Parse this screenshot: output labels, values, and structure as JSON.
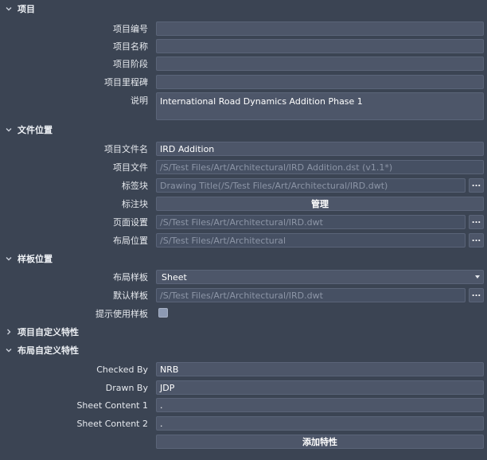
{
  "sections": {
    "project": "项目",
    "file_location": "文件位置",
    "template_location": "样板位置",
    "project_custom": "项目自定义特性",
    "layout_custom": "布局自定义特性"
  },
  "project": {
    "number_label": "项目编号",
    "number_value": "",
    "name_label": "项目名称",
    "name_value": "",
    "phase_label": "项目阶段",
    "phase_value": "",
    "milestone_label": "项目里程碑",
    "milestone_value": "",
    "desc_label": "说明",
    "desc_value": "International Road Dynamics Addition Phase 1"
  },
  "file_location": {
    "filename_label": "项目文件名",
    "filename_value": "IRD Addition",
    "file_label": "项目文件",
    "file_value": "/S/Test Files/Art/Architectural/IRD Addition.dst (v1.1*)",
    "label_block_label": "标签块",
    "label_block_value": "Drawing Title(/S/Test Files/Art/Architectural/IRD.dwt)",
    "annot_block_label": "标注块",
    "annot_block_button": "管理",
    "page_setup_label": "页面设置",
    "page_setup_value": "/S/Test Files/Art/Architectural/IRD.dwt",
    "layout_loc_label": "布局位置",
    "layout_loc_value": "/S/Test Files/Art/Architectural",
    "ellipsis": "..."
  },
  "template_location": {
    "layout_template_label": "布局样板",
    "layout_template_value": "Sheet",
    "default_template_label": "默认样板",
    "default_template_value": "/S/Test Files/Art/Architectural/IRD.dwt",
    "prompt_label": "提示使用样板",
    "prompt_checked": true
  },
  "layout_custom": {
    "checked_by_label": "Checked By",
    "checked_by_value": "NRB",
    "drawn_by_label": "Drawn By",
    "drawn_by_value": "JDP",
    "sheet_content1_label": "Sheet Content 1",
    "sheet_content1_value": ".",
    "sheet_content2_label": "Sheet Content 2",
    "sheet_content2_value": ".",
    "add_property_button": "添加特性"
  },
  "icons": {
    "chevron_expanded": "chevron-down-icon",
    "chevron_collapsed": "chevron-right-icon",
    "dropdown_caret": "caret-down-icon"
  },
  "colors": {
    "background": "#3b4453",
    "field_bg": "#4d5669",
    "disabled_text": "#8c95a6",
    "checkbox": "#8d9ab3"
  }
}
